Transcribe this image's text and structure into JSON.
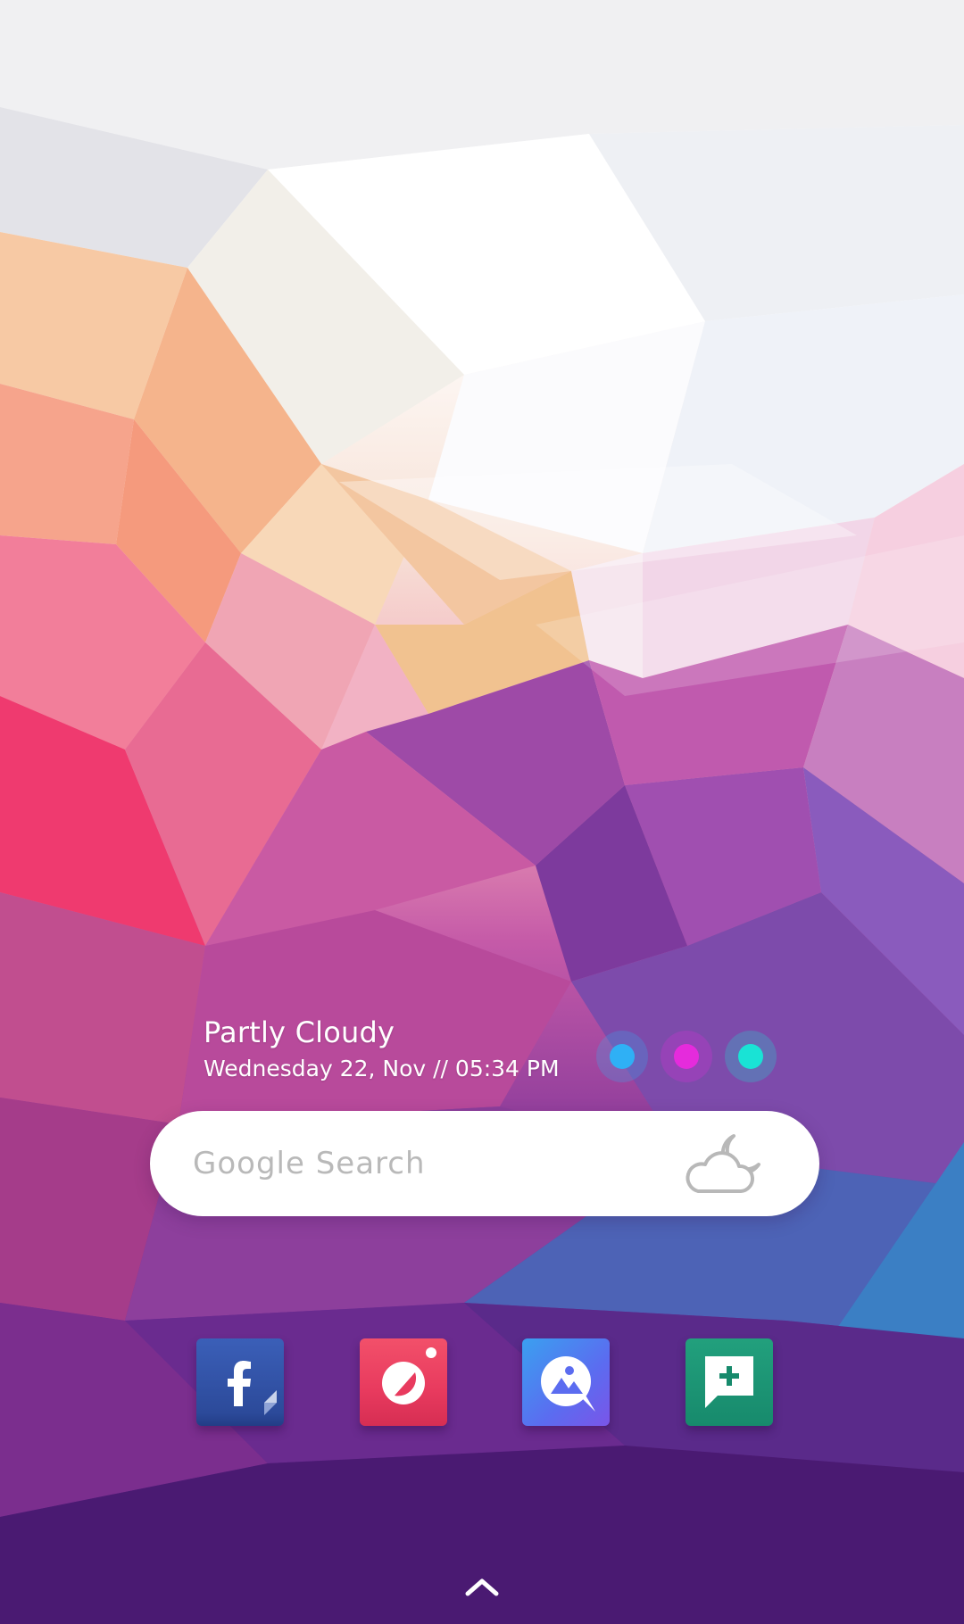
{
  "weather": {
    "condition": "Partly Cloudy",
    "datetime": "Wednesday 22, Nov // 05:34 PM",
    "icon": "partly-cloudy-night-icon"
  },
  "color_dots": [
    {
      "name": "blue",
      "color": "#2fb0f5"
    },
    {
      "name": "magenta",
      "color": "#e52bdc"
    },
    {
      "name": "cyan",
      "color": "#19e3d5"
    }
  ],
  "search": {
    "placeholder": "Google Search"
  },
  "dock": {
    "apps": [
      {
        "icon": "facebook-icon",
        "color": "#2f4fa3"
      },
      {
        "icon": "camera-icon",
        "color": "#e83a5e"
      },
      {
        "icon": "gallery-icon",
        "color": "#5b6cf0"
      },
      {
        "icon": "messages-icon",
        "color": "#178a6c"
      }
    ]
  },
  "app_drawer": {
    "icon": "chevron-up-icon"
  }
}
